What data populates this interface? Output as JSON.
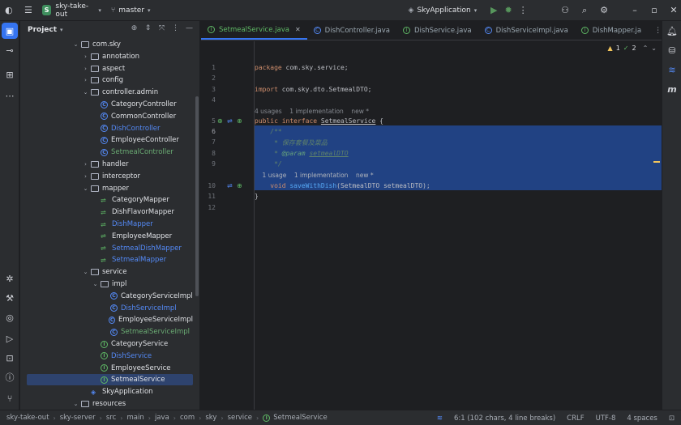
{
  "titlebar": {
    "project_badge": "S",
    "project_name": "sky-take-out",
    "branch": "master",
    "run_config": "SkyApplication"
  },
  "left_icons": [
    "folder-icon",
    "commit-icon",
    "structure-icon",
    "more-icon",
    "debug-icon",
    "build-icon",
    "services-icon",
    "run-icon",
    "terminal-icon",
    "problems-icon",
    "git-icon"
  ],
  "right_icons": [
    "notifications-icon",
    "database-icon",
    "gradle-icon",
    "ai-icon"
  ],
  "project_panel": {
    "title": "Project",
    "tree": [
      {
        "label": "com.sky",
        "type": "folder",
        "depth": 0,
        "expanded": true
      },
      {
        "label": "annotation",
        "type": "folder",
        "depth": 1,
        "expanded": false
      },
      {
        "label": "aspect",
        "type": "folder",
        "depth": 1,
        "expanded": false
      },
      {
        "label": "config",
        "type": "folder",
        "depth": 1,
        "expanded": false
      },
      {
        "label": "controller.admin",
        "type": "folder",
        "depth": 1,
        "expanded": true
      },
      {
        "label": "CategoryController",
        "type": "class",
        "depth": 2
      },
      {
        "label": "CommonController",
        "type": "class",
        "depth": 2
      },
      {
        "label": "DishController",
        "type": "class",
        "depth": 2,
        "color": "blue"
      },
      {
        "label": "EmployeeController",
        "type": "class",
        "depth": 2
      },
      {
        "label": "SetmealController",
        "type": "class",
        "depth": 2,
        "color": "green"
      },
      {
        "label": "handler",
        "type": "folder",
        "depth": 1,
        "expanded": false
      },
      {
        "label": "interceptor",
        "type": "folder",
        "depth": 1,
        "expanded": false
      },
      {
        "label": "mapper",
        "type": "folder",
        "depth": 1,
        "expanded": true
      },
      {
        "label": "CategoryMapper",
        "type": "mapper",
        "depth": 2
      },
      {
        "label": "DishFlavorMapper",
        "type": "mapper",
        "depth": 2
      },
      {
        "label": "DishMapper",
        "type": "mapper",
        "depth": 2,
        "color": "blue"
      },
      {
        "label": "EmployeeMapper",
        "type": "mapper",
        "depth": 2
      },
      {
        "label": "SetmealDishMapper",
        "type": "mapper",
        "depth": 2,
        "color": "blue"
      },
      {
        "label": "SetmealMapper",
        "type": "mapper",
        "depth": 2,
        "color": "blue"
      },
      {
        "label": "service",
        "type": "folder",
        "depth": 1,
        "expanded": true
      },
      {
        "label": "impl",
        "type": "folder",
        "depth": 2,
        "expanded": true
      },
      {
        "label": "CategoryServiceImpl",
        "type": "class",
        "depth": 3
      },
      {
        "label": "DishServiceImpl",
        "type": "class",
        "depth": 3,
        "color": "blue"
      },
      {
        "label": "EmployeeServiceImpl",
        "type": "class",
        "depth": 3
      },
      {
        "label": "SetmealServiceImpl",
        "type": "class",
        "depth": 3,
        "color": "green"
      },
      {
        "label": "CategoryService",
        "type": "iface",
        "depth": 2
      },
      {
        "label": "DishService",
        "type": "iface",
        "depth": 2,
        "color": "blue"
      },
      {
        "label": "EmployeeService",
        "type": "iface",
        "depth": 2
      },
      {
        "label": "SetmealService",
        "type": "iface",
        "depth": 2,
        "selected": true
      },
      {
        "label": "SkyApplication",
        "type": "app",
        "depth": 1
      },
      {
        "label": "resources",
        "type": "folder",
        "depth": 0,
        "expanded": true
      }
    ]
  },
  "tabs": [
    {
      "label": "SetmealService.java",
      "active": true,
      "kind": "iface"
    },
    {
      "label": "DishController.java",
      "active": false,
      "kind": "class"
    },
    {
      "label": "DishService.java",
      "active": false,
      "kind": "iface"
    },
    {
      "label": "DishServiceImpl.java",
      "active": false,
      "kind": "class"
    },
    {
      "label": "DishMapper.ja",
      "active": false,
      "kind": "iface"
    }
  ],
  "inspections": {
    "warnings": "1",
    "ok": "2"
  },
  "code": {
    "line_numbers": [
      "1",
      "2",
      "3",
      "4",
      "5",
      "6",
      "7",
      "8",
      "9",
      "10",
      "11",
      "12"
    ],
    "line1": {
      "kw": "package",
      "rest": " com.sky.service;"
    },
    "line3": {
      "kw": "import",
      "rest": " com.sky.dto.SetmealDTO;"
    },
    "hint1": "4 usages    1 implementation    new *",
    "line5": {
      "kw1": "public",
      "kw2": "interface",
      "name": "SetmealService",
      "rest": " {"
    },
    "line6": "    /**",
    "line7": "     * 保存套餐及菜品",
    "line8": {
      "prefix": "     * ",
      "tag": "@param",
      "param": "setmealDTO"
    },
    "line9": "     */",
    "hint2": "    1 usage    1 implementation    new *",
    "line10": {
      "kw": "void",
      "fn": "saveWithDish",
      "rest": "(SetmealDTO setmealDTO);"
    },
    "line11": "}"
  },
  "statusbar": {
    "breadcrumb": [
      "sky-take-out",
      "sky-server",
      "src",
      "main",
      "java",
      "com",
      "sky",
      "service",
      "SetmealService"
    ],
    "position": "6:1 (102 chars, 4 line breaks)",
    "line_sep": "CRLF",
    "encoding": "UTF-8",
    "indent": "4 spaces"
  }
}
